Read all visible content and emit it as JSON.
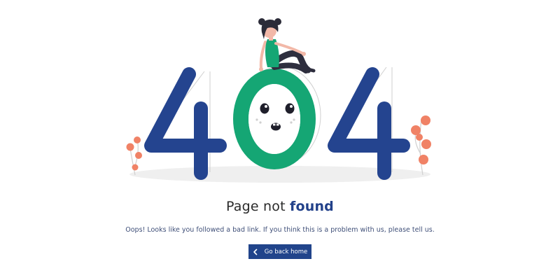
{
  "illustration": {
    "digits": [
      "4",
      "0",
      "4"
    ],
    "colors": {
      "primary_blue": "#24448f",
      "green": "#15a674",
      "coral": "#f08266",
      "outline": "#cfcfcf",
      "shadow": "#eeeeee",
      "skin": "#f2b8a8",
      "hair": "#2b2b38"
    }
  },
  "title": {
    "prefix": "Page not ",
    "emphasis": "found"
  },
  "message": "Oops! Looks like you followed a bad link. If you think this is a problem with us, please tell us.",
  "button": {
    "label": "Go back home",
    "icon": "chevron-left-icon"
  }
}
